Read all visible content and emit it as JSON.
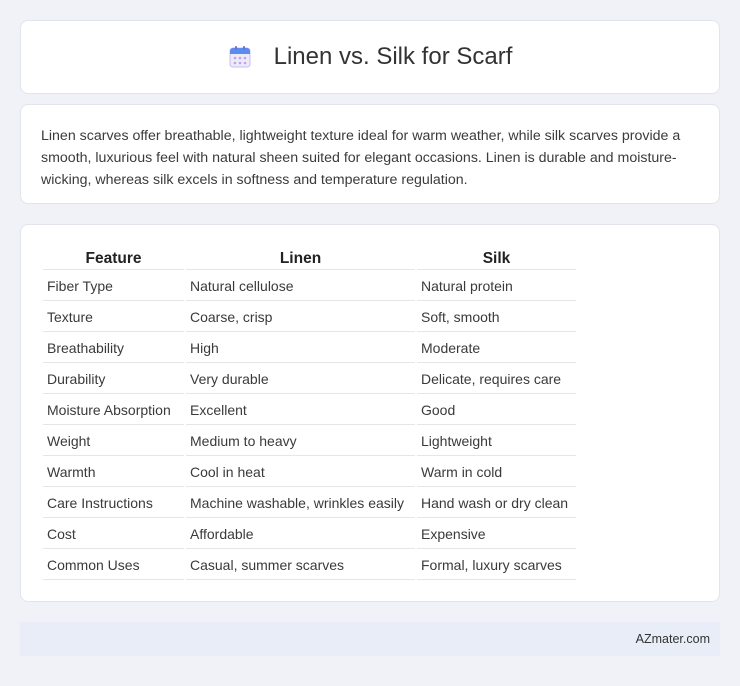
{
  "header": {
    "icon": "calendar-icon",
    "title": "Linen vs. Silk for Scarf"
  },
  "summary": {
    "text": "Linen scarves offer breathable, lightweight texture ideal for warm weather, while silk scarves provide a smooth, luxurious feel with natural sheen suited for elegant occasions. Linen is durable and moisture-wicking, whereas silk excels in softness and temperature regulation."
  },
  "table": {
    "headers": [
      "Feature",
      "Linen",
      "Silk"
    ],
    "rows": [
      [
        "Fiber Type",
        "Natural cellulose",
        "Natural protein"
      ],
      [
        "Texture",
        "Coarse, crisp",
        "Soft, smooth"
      ],
      [
        "Breathability",
        "High",
        "Moderate"
      ],
      [
        "Durability",
        "Very durable",
        "Delicate, requires care"
      ],
      [
        "Moisture Absorption",
        "Excellent",
        "Good"
      ],
      [
        "Weight",
        "Medium to heavy",
        "Lightweight"
      ],
      [
        "Warmth",
        "Cool in heat",
        "Warm in cold"
      ],
      [
        "Care Instructions",
        "Machine washable, wrinkles easily",
        "Hand wash or dry clean"
      ],
      [
        "Cost",
        "Affordable",
        "Expensive"
      ],
      [
        "Common Uses",
        "Casual, summer scarves",
        "Formal, luxury scarves"
      ]
    ]
  },
  "footer": {
    "brand": "AZmater.com"
  },
  "colors": {
    "page_background": "#f0f2f7",
    "card_background": "#ffffff",
    "footer_background": "#e8edf7",
    "icon_blue": "#5b8def",
    "icon_purple": "#b9a6e8"
  }
}
